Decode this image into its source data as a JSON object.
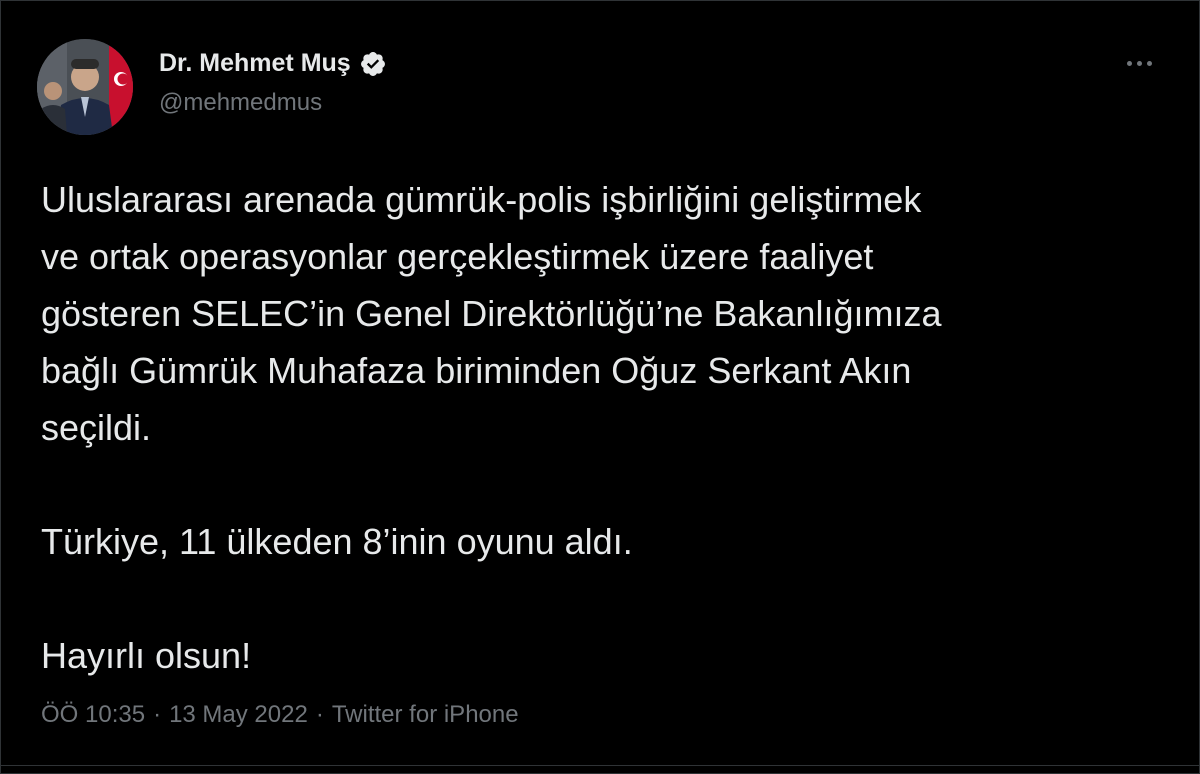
{
  "author": {
    "name": "Dr. Mehmet Muş",
    "handle": "@mehmedmus",
    "verified": true,
    "avatar_icon": "profile-photo",
    "verified_icon": "verified-badge-icon"
  },
  "menu": {
    "icon": "more-options-icon"
  },
  "tweet": {
    "paragraphs": [
      "Uluslararası arenada gümrük-polis işbirliğini geliştirmek\nve ortak operasyonlar gerçekleştirmek üzere faaliyet\ngösteren SELEC’in Genel Direktörlüğü’ne Bakanlığımıza\nbağlı Gümrük Muhafaza biriminden Oğuz Serkant Akın\nseçildi.",
      "Türkiye, 11 ülkeden 8’inin oyunu aldı.",
      "Hayırlı olsun!"
    ]
  },
  "meta": {
    "time": "ÖÖ 10:35",
    "separator": "·",
    "date": "13 May 2022",
    "source": "Twitter for iPhone"
  },
  "colors": {
    "background": "#000000",
    "text": "#e7e9ea",
    "secondary": "#71767b",
    "verified": "#e7e9ea"
  }
}
